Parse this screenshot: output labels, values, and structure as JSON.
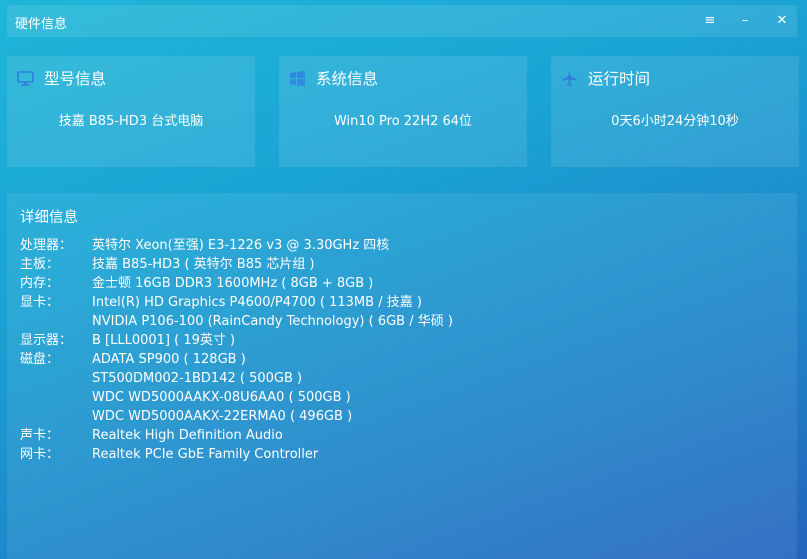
{
  "window": {
    "title": "硬件信息",
    "buttons": {
      "menu": "≡",
      "minimize": "–",
      "close": "✕"
    }
  },
  "cards": [
    {
      "icon": "monitor-icon",
      "label": "型号信息",
      "value": "技嘉  B85-HD3 台式电脑"
    },
    {
      "icon": "windows-logo-icon",
      "label": "系统信息",
      "value": "Win10 Pro 22H2 64位"
    },
    {
      "icon": "airplane-icon",
      "label": "运行时间",
      "value": "0天6小时24分钟10秒"
    }
  ],
  "details": {
    "title": "详细信息",
    "rows": [
      {
        "key": "处理器：",
        "value": "英特尔 Xeon(至强) E3-1226 v3 @ 3.30GHz 四核"
      },
      {
        "key": "主板：",
        "value": "技嘉 B85-HD3 ( 英特尔 B85 芯片组 )"
      },
      {
        "key": "内存：",
        "value": "金士顿 16GB DDR3 1600MHz ( 8GB + 8GB )"
      },
      {
        "key": "显卡：",
        "value": "Intel(R) HD Graphics P4600/P4700 ( 113MB / 技嘉 )"
      },
      {
        "key": "",
        "value": "NVIDIA P106-100 (RainCandy Technology) ( 6GB / 华硕 )"
      },
      {
        "key": "显示器：",
        "value": "B [LLL0001] ( 19英寸 )"
      },
      {
        "key": "磁盘：",
        "value": "ADATA SP900 ( 128GB )"
      },
      {
        "key": "",
        "value": "ST500DM002-1BD142 ( 500GB )"
      },
      {
        "key": "",
        "value": "WDC WD5000AAKX-08U6AA0 ( 500GB )"
      },
      {
        "key": "",
        "value": "WDC WD5000AAKX-22ERMA0 ( 496GB )"
      },
      {
        "key": "声卡：",
        "value": "Realtek High Definition Audio"
      },
      {
        "key": "网卡：",
        "value": "Realtek PCIe GbE Family Controller"
      }
    ]
  }
}
